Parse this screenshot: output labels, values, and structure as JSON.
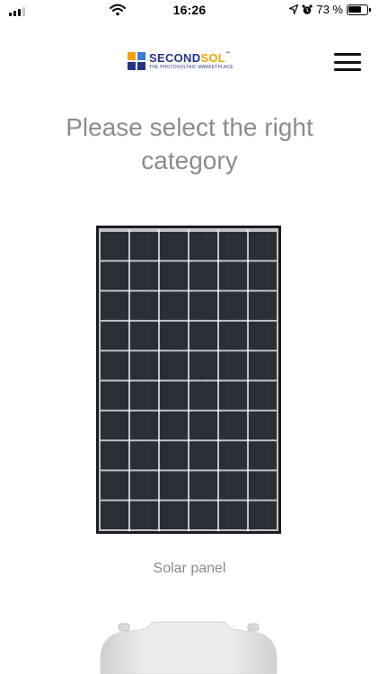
{
  "status_bar": {
    "time": "16:26",
    "battery_text": "73 %",
    "battery_level": 0.73,
    "icons": [
      "cellular-signal-icon",
      "wifi-icon",
      "location-arrow-icon",
      "alarm-icon",
      "battery-icon"
    ]
  },
  "header": {
    "logo": {
      "name_part1": "SECOND",
      "name_part2": "SOL",
      "trademark": "™",
      "tagline": "THE PHOTOVOLTAIC MARKETPLACE",
      "colors": {
        "navy": "#25348b",
        "orange": "#f0a500",
        "light_blue": "#3a7bd5"
      }
    },
    "menu_icon": "hamburger-menu-icon"
  },
  "main": {
    "heading": "Please select the right category",
    "categories": [
      {
        "label": "Solar panel",
        "image": "solar-panel-image"
      }
    ]
  },
  "colors": {
    "heading_text": "#8c8c8c",
    "label_text": "#8a8a8a",
    "panel_frame": "#1a1c20",
    "panel_cell": "#2a2e35"
  }
}
